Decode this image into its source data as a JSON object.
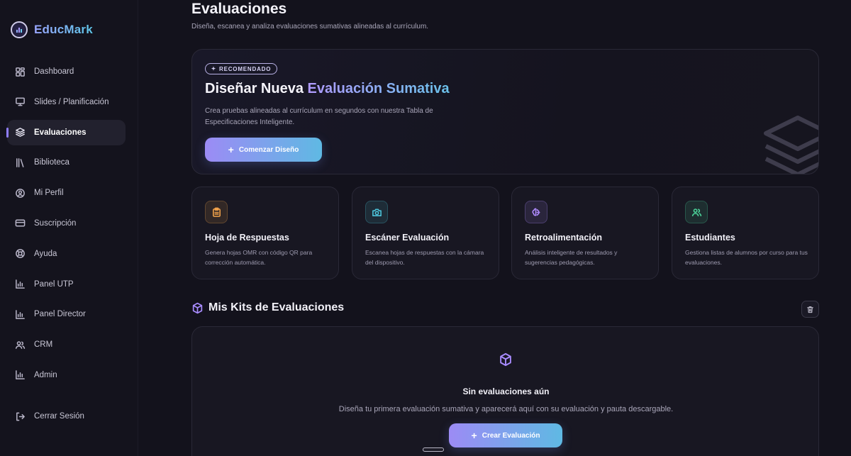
{
  "app": {
    "name": "EducMark"
  },
  "sidebar": {
    "items": [
      {
        "label": "Dashboard",
        "icon": "dashboard-icon",
        "active": false
      },
      {
        "label": "Slides / Planificación",
        "icon": "presentation-icon",
        "active": false
      },
      {
        "label": "Evaluaciones",
        "icon": "layers-icon",
        "active": true
      },
      {
        "label": "Biblioteca",
        "icon": "library-icon",
        "active": false
      },
      {
        "label": "Mi Perfil",
        "icon": "user-circle-icon",
        "active": false
      },
      {
        "label": "Suscripción",
        "icon": "credit-card-icon",
        "active": false
      },
      {
        "label": "Ayuda",
        "icon": "lifebuoy-icon",
        "active": false
      },
      {
        "label": "Panel UTP",
        "icon": "bar-chart-icon",
        "active": false
      },
      {
        "label": "Panel Director",
        "icon": "bar-chart-icon",
        "active": false
      },
      {
        "label": "CRM",
        "icon": "users-icon",
        "active": false
      },
      {
        "label": "Admin",
        "icon": "bar-chart-icon",
        "active": false
      }
    ],
    "logout_label": "Cerrar Sesión"
  },
  "header": {
    "title": "Evaluaciones",
    "subtitle": "Diseña, escanea y analiza evaluaciones sumativas alineadas al currículum."
  },
  "hero": {
    "badge": "RECOMENDADO",
    "title_prefix": "Diseñar Nueva",
    "title_accent": "Evaluación Sumativa",
    "description": "Crea pruebas alineadas al currículum en segundos con nuestra Tabla de Especificaciones Inteligente.",
    "button_label": "Comenzar Diseño"
  },
  "cards": [
    {
      "title": "Hoja de Respuestas",
      "description": "Genera hojas OMR con código QR para corrección automática.",
      "icon": "clipboard-icon",
      "color": "#f0a14a"
    },
    {
      "title": "Escáner Evaluación",
      "description": "Escanea hojas de respuestas con la cámara del dispositivo.",
      "icon": "camera-icon",
      "color": "#4cc3d9"
    },
    {
      "title": "Retroalimentación",
      "description": "Análisis inteligente de resultados y sugerencias pedagógicas.",
      "icon": "brain-icon",
      "color": "#b08cff"
    },
    {
      "title": "Estudiantes",
      "description": "Gestiona listas de alumnos por curso para tus evaluaciones.",
      "icon": "users-icon",
      "color": "#4cd39a"
    }
  ],
  "kits": {
    "title": "Mis Kits de Evaluaciones",
    "empty_title": "Sin evaluaciones aún",
    "empty_description": "Diseña tu primera evaluación sumativa y aparecerá aquí con su evaluación y pauta descargable.",
    "button_label": "Crear Evaluación"
  },
  "colors": {
    "accent": "#8f7dff",
    "accent_secondary": "#5fb9e3",
    "background": "#13121c"
  }
}
